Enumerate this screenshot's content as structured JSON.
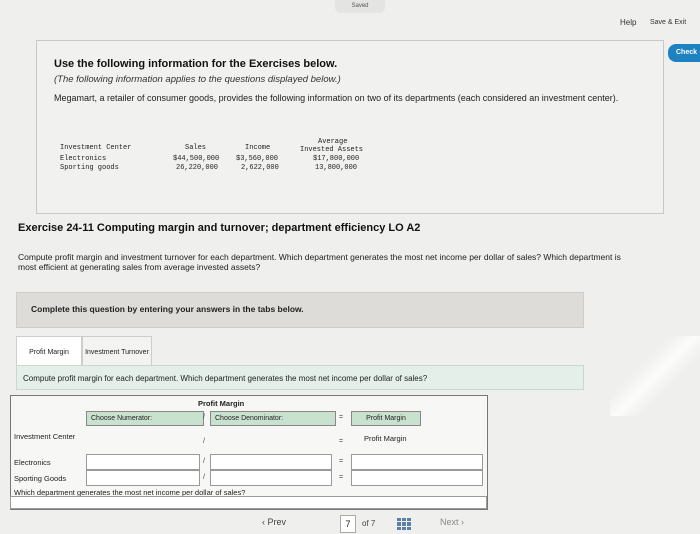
{
  "header": {
    "saved": "Saved",
    "help": "Help",
    "save_exit": "Save & Exit",
    "check": "Check"
  },
  "info": {
    "title": "Use the following information for the Exercises below.",
    "subtitle": "(The following information applies to the questions displayed below.)",
    "intro": "Megamart, a retailer of consumer goods, provides the following information on two of its departments (each considered an investment center).",
    "table": {
      "col_center": "Investment Center",
      "col_sales": "Sales",
      "col_income": "Income",
      "col_avg1": "Average",
      "col_avg2": "Invested Assets",
      "rows": [
        {
          "name": "Electronics",
          "sales": "$44,500,000",
          "income": "$3,560,000",
          "assets": "$17,800,000"
        },
        {
          "name": "Sporting goods",
          "sales": "26,220,000",
          "income": "2,622,000",
          "assets": "13,800,000"
        }
      ]
    }
  },
  "exercise": {
    "title": "Exercise 24-11 Computing margin and turnover; department efficiency LO A2",
    "text": "Compute profit margin and investment turnover for each department. Which department generates the most net income per dollar of sales? Which department is most efficient at generating sales from average invested assets?",
    "complete": "Complete this question by entering your answers in the tabs below."
  },
  "tabs": [
    {
      "label": "Profit Margin"
    },
    {
      "label": "Investment Turnover"
    }
  ],
  "question": "Compute profit margin for each department. Which department generates the most net income per dollar of sales?",
  "grid": {
    "title": "Profit Margin",
    "numerator": "Choose Numerator:",
    "slash": "/",
    "denominator": "Choose Denominator:",
    "eq": "=",
    "result_header": "Profit Margin",
    "result_header2": "Profit Margin",
    "row1": "Investment Center",
    "row2": "Electronics",
    "row3": "Sporting Goods",
    "footer": "Which department generates the most net income per dollar of sales?"
  },
  "pager": {
    "prev": "Prev",
    "page": "7",
    "of": "of 7",
    "next": "Next"
  }
}
